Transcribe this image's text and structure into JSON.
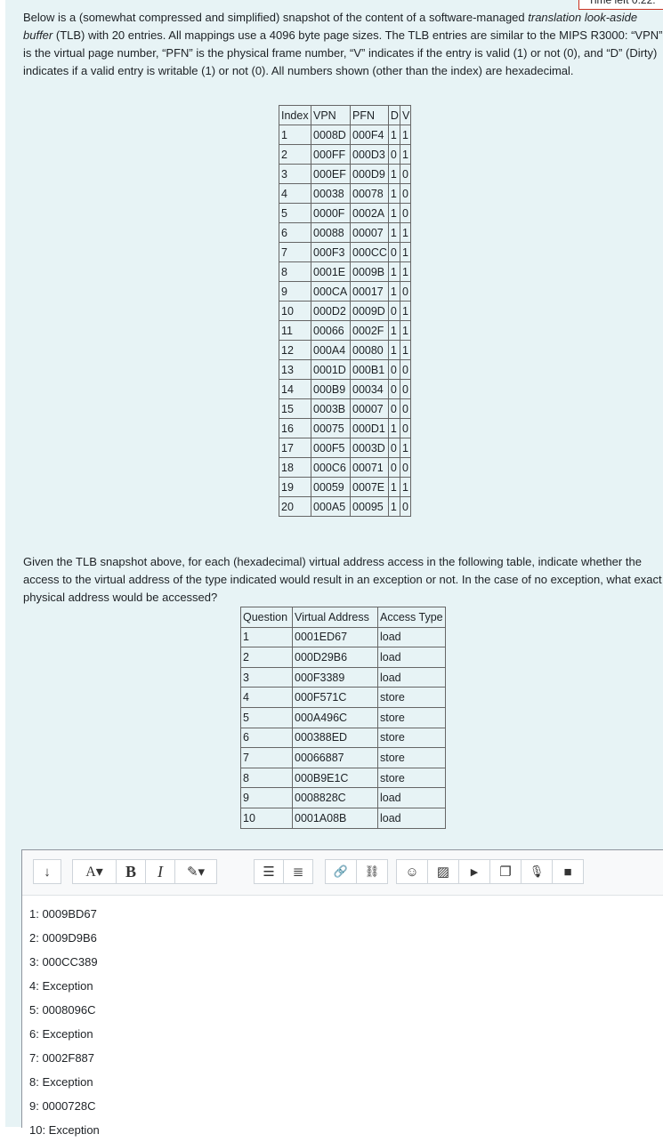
{
  "timer": {
    "text": "Time left 0:22:"
  },
  "intro": {
    "part1": "Below is a (somewhat compressed and simplified) snapshot of the content of a software-managed ",
    "term": "translation look-aside buffer",
    "part2": " (TLB) with 20 entries. All mappings use a 4096 byte page sizes. The TLB entries are similar to the MIPS R3000: “VPN” is the virtual page number, “PFN” is the physical frame number, “V” indicates if the entry is valid (1) or not (0), and “D” (Dirty) indicates if a valid entry is writable (1) or not (0). All numbers shown (other than the index) are hexadecimal."
  },
  "tlb_table": {
    "headers": [
      "Index",
      "VPN",
      "PFN",
      "D",
      "V"
    ],
    "rows": [
      [
        "1",
        "0008D",
        "000F4",
        "1",
        "1"
      ],
      [
        "2",
        "000FF",
        "000D3",
        "0",
        "1"
      ],
      [
        "3",
        "000EF",
        "000D9",
        "1",
        "0"
      ],
      [
        "4",
        "00038",
        "00078",
        "1",
        "0"
      ],
      [
        "5",
        "0000F",
        "0002A",
        "1",
        "0"
      ],
      [
        "6",
        "00088",
        "00007",
        "1",
        "1"
      ],
      [
        "7",
        "000F3",
        "000CC",
        "0",
        "1"
      ],
      [
        "8",
        "0001E",
        "0009B",
        "1",
        "1"
      ],
      [
        "9",
        "000CA",
        "00017",
        "1",
        "0"
      ],
      [
        "10",
        "000D2",
        "0009D",
        "0",
        "1"
      ],
      [
        "11",
        "00066",
        "0002F",
        "1",
        "1"
      ],
      [
        "12",
        "000A4",
        "00080",
        "1",
        "1"
      ],
      [
        "13",
        "0001D",
        "000B1",
        "0",
        "0"
      ],
      [
        "14",
        "000B9",
        "00034",
        "0",
        "0"
      ],
      [
        "15",
        "0003B",
        "00007",
        "0",
        "0"
      ],
      [
        "16",
        "00075",
        "000D1",
        "1",
        "0"
      ],
      [
        "17",
        "000F5",
        "0003D",
        "0",
        "1"
      ],
      [
        "18",
        "000C6",
        "00071",
        "0",
        "0"
      ],
      [
        "19",
        "00059",
        "0007E",
        "1",
        "1"
      ],
      [
        "20",
        "000A5",
        "00095",
        "1",
        "0"
      ]
    ]
  },
  "given_text": "Given the TLB snapshot above, for each (hexadecimal) virtual address access in the following table, indicate whether the access to the virtual address of the type indicated would result in an exception or not. In the case of no exception, what exact physical address would be accessed?",
  "question_table": {
    "headers": [
      "Question",
      "Virtual Address",
      "Access Type"
    ],
    "rows": [
      [
        "1",
        "0001ED67",
        "load"
      ],
      [
        "2",
        "000D29B6",
        "load"
      ],
      [
        "3",
        "000F3389",
        "load"
      ],
      [
        "4",
        "000F571C",
        "store"
      ],
      [
        "5",
        "000A496C",
        "store"
      ],
      [
        "6",
        "000388ED",
        "store"
      ],
      [
        "7",
        "00066887",
        "store"
      ],
      [
        "8",
        "000B9E1C",
        "store"
      ],
      [
        "9",
        "0008828C",
        "load"
      ],
      [
        "10",
        "0001A08B",
        "load"
      ]
    ]
  },
  "toolbar": {
    "buttons": [
      {
        "name": "collapse-button",
        "icon": "arrow-down-icon",
        "glyph": "↓"
      },
      {
        "name": "font-style-button",
        "icon": "font-icon",
        "glyph": "A▾"
      },
      {
        "name": "bold-button",
        "icon": "bold-icon",
        "glyph": "B"
      },
      {
        "name": "italic-button",
        "icon": "italic-icon",
        "glyph": "I"
      },
      {
        "name": "font-color-button",
        "icon": "brush-icon",
        "glyph": "✎▾"
      },
      {
        "name": "unordered-list-button",
        "icon": "list-ul-icon",
        "glyph": "☰"
      },
      {
        "name": "ordered-list-button",
        "icon": "list-ol-icon",
        "glyph": "≣"
      },
      {
        "name": "link-button",
        "icon": "link-icon",
        "glyph": "🔗"
      },
      {
        "name": "unlink-button",
        "icon": "unlink-icon",
        "glyph": "⛓"
      },
      {
        "name": "emoji-button",
        "icon": "smile-icon",
        "glyph": "☺"
      },
      {
        "name": "image-button",
        "icon": "image-icon",
        "glyph": "▨"
      },
      {
        "name": "media-button",
        "icon": "media-icon",
        "glyph": "▶"
      },
      {
        "name": "manage-files-button",
        "icon": "files-icon",
        "glyph": "❐"
      },
      {
        "name": "record-audio-button",
        "icon": "microphone-icon",
        "glyph": "🎙"
      },
      {
        "name": "record-video-button",
        "icon": "video-icon",
        "glyph": "■"
      }
    ]
  },
  "answers": [
    "1: 0009BD67",
    "2: 0009D9B6",
    "3: 000CC389",
    "4: Exception",
    "5: 0008096C",
    "6: Exception",
    "7: 0002F887",
    "8: Exception",
    "9: 0000728C",
    "10: Exception"
  ]
}
